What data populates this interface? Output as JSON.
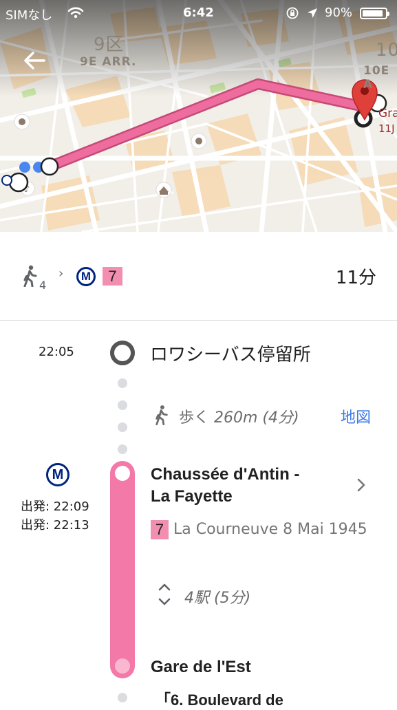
{
  "status_bar": {
    "carrier": "SIMなし",
    "time": "6:42",
    "battery": "90%",
    "battery_level": 0.9
  },
  "map": {
    "labels": {
      "district_9_jp": "9区",
      "district_9_fr": "9E ARR.",
      "district_10_jp": "10",
      "district_10_fr": "10E A",
      "dest_label_1": "Gra",
      "dest_label_2": "11J"
    },
    "route_color": "#ee6d9e",
    "marker_color": "#e0403a"
  },
  "summary": {
    "walk_minutes": "4",
    "metro_symbol": "M",
    "line": "7",
    "duration": "11分"
  },
  "timeline": {
    "start_time": "22:05",
    "start_stop": "ロワシーバス停留所",
    "walk_label": "歩く",
    "walk_detail": "260m (4分)",
    "map_link": "地図",
    "metro_symbol": "M",
    "departure_1": "出発: 22:09",
    "departure_2": "出発: 22:13",
    "board_station_line1": "Chaussée d'Antin -",
    "board_station_line2": "La Fayette",
    "line": "7",
    "direction": "La Courneuve 8 Mai 1945",
    "stops_label": "4駅",
    "stops_time": "(5分)",
    "alight_station": "Gare de l'Est",
    "next_label": "「6. Boulevard de"
  },
  "colors": {
    "metro_blue": "#00237f",
    "line_7_pink": "#f28fb0",
    "link_blue": "#3b78e7"
  }
}
